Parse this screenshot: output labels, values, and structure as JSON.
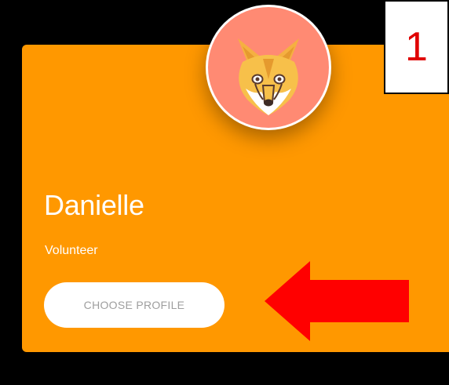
{
  "profile": {
    "name": "Danielle",
    "role": "Volunteer",
    "avatar_icon": "fox-icon",
    "choose_label": "CHOOSE PROFILE"
  },
  "annotation": {
    "step_number": "1",
    "arrow_icon": "arrow-left-icon",
    "arrow_color": "#FF0000"
  },
  "colors": {
    "card": "#FF9800",
    "avatar_bg": "#FF8A73",
    "background": "#000000",
    "button_text": "#9E9E9E"
  }
}
